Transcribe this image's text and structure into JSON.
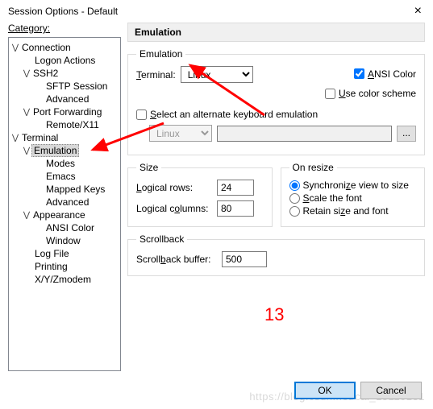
{
  "window": {
    "title": "Session Options - Default"
  },
  "left": {
    "category_label": "Category:",
    "items": {
      "connection": "Connection",
      "logon": "Logon Actions",
      "ssh2": "SSH2",
      "sftp": "SFTP Session",
      "adv1": "Advanced",
      "portfwd": "Port Forwarding",
      "remotex": "Remote/X11",
      "terminal": "Terminal",
      "emulation": "Emulation",
      "modes": "Modes",
      "emacs": "Emacs",
      "mapped": "Mapped Keys",
      "adv2": "Advanced",
      "appearance": "Appearance",
      "ansi": "ANSI Color",
      "window": "Window",
      "logfile": "Log File",
      "printing": "Printing",
      "xyz": "X/Y/Zmodem"
    }
  },
  "panel": {
    "heading": "Emulation",
    "group_emu": "Emulation",
    "terminal_label": "Terminal:",
    "terminal_value": "Linux",
    "ansi_label_pre": "A",
    "ansi_label_post": "NSI Color",
    "colorscheme_label": "Use color scheme",
    "alt_keyboard_label": "Select an alternate keyboard emulation",
    "alt_select_value": "Linux",
    "browse": "...",
    "group_size": "Size",
    "rows_label": "Logical rows:",
    "rows_value": "24",
    "cols_label": "Logical columns:",
    "cols_value": "80",
    "group_resize": "On resize",
    "r1": "Synchronize view to size",
    "r2": "Scale the font",
    "r3": "Retain size and font",
    "group_scroll": "Scrollback",
    "scroll_label": "Scrollback buffer:",
    "scroll_value": "500"
  },
  "buttons": {
    "ok": "OK",
    "cancel": "Cancel"
  },
  "annotation": {
    "number": "13"
  },
  "watermark": "https://blog.csdn.net/cai_15110131"
}
